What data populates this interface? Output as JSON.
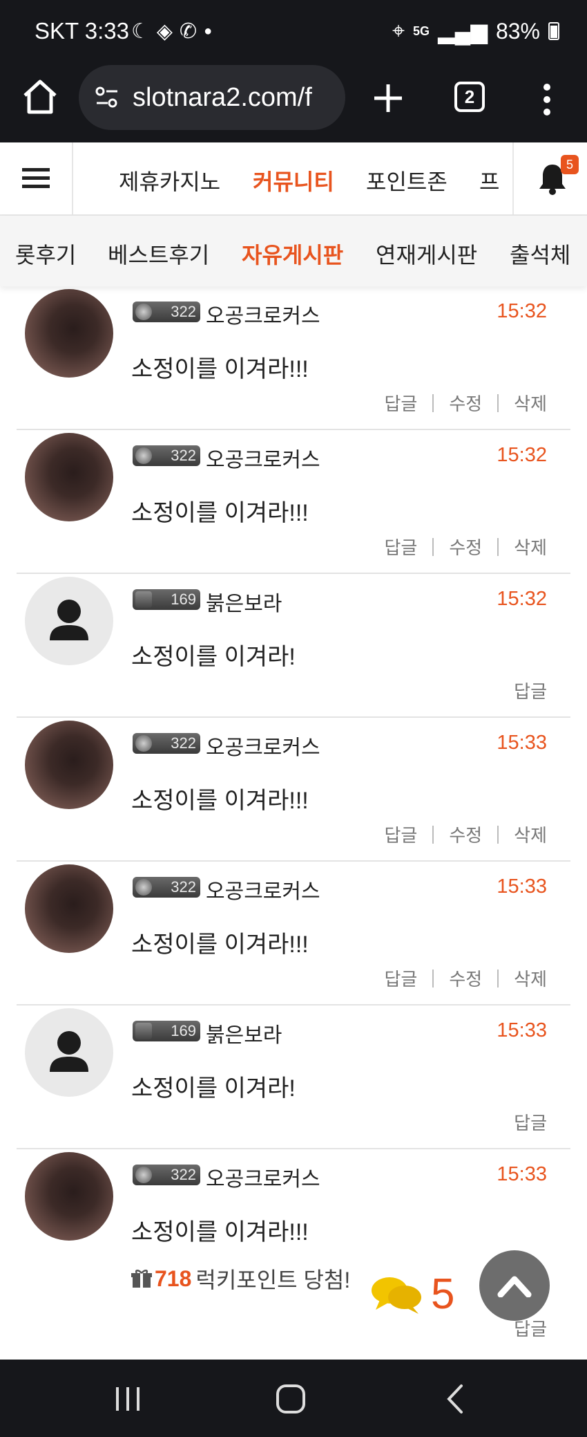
{
  "status_bar": {
    "carrier_time": "SKT 3:33",
    "signal": "5G",
    "battery": "83%"
  },
  "browser": {
    "url": "slotnara2.com/f",
    "tab_count": "2"
  },
  "site_nav": {
    "items": [
      "제휴카지노",
      "커뮤니티",
      "포인트존",
      "프"
    ],
    "active_index": 1,
    "notification_count": "5"
  },
  "sub_nav": {
    "items": [
      "롯후기",
      "베스트후기",
      "자유게시판",
      "연재게시판",
      "출석체"
    ],
    "active_index": 2
  },
  "comments": [
    {
      "level": "322",
      "nick": "오공크로커스",
      "time": "15:32",
      "text": "소정이를 이겨라!!!",
      "actions": [
        "답글",
        "수정",
        "삭제"
      ]
    },
    {
      "level": "322",
      "nick": "오공크로커스",
      "time": "15:32",
      "text": "소정이를 이겨라!!!",
      "actions": [
        "답글",
        "수정",
        "삭제"
      ]
    },
    {
      "level": "169",
      "nick": "붉은보라",
      "time": "15:32",
      "text": "소정이를 이겨라!",
      "actions": [
        "답글"
      ]
    },
    {
      "level": "322",
      "nick": "오공크로커스",
      "time": "15:33",
      "text": "소정이를 이겨라!!!",
      "actions": [
        "답글",
        "수정",
        "삭제"
      ]
    },
    {
      "level": "322",
      "nick": "오공크로커스",
      "time": "15:33",
      "text": "소정이를 이겨라!!!",
      "actions": [
        "답글",
        "수정",
        "삭제"
      ]
    },
    {
      "level": "169",
      "nick": "붉은보라",
      "time": "15:33",
      "text": "소정이를 이겨라!",
      "actions": [
        "답글"
      ]
    },
    {
      "level": "322",
      "nick": "오공크로커스",
      "time": "15:33",
      "text": "소정이를 이겨라!!!",
      "actions": [
        "답글"
      ],
      "lucky_points": "718",
      "lucky_text": "럭키포인트 당첨!"
    }
  ],
  "floating": {
    "comment_count": "5"
  },
  "colors": {
    "accent": "#e8541e",
    "dark_bar": "#16171b"
  }
}
